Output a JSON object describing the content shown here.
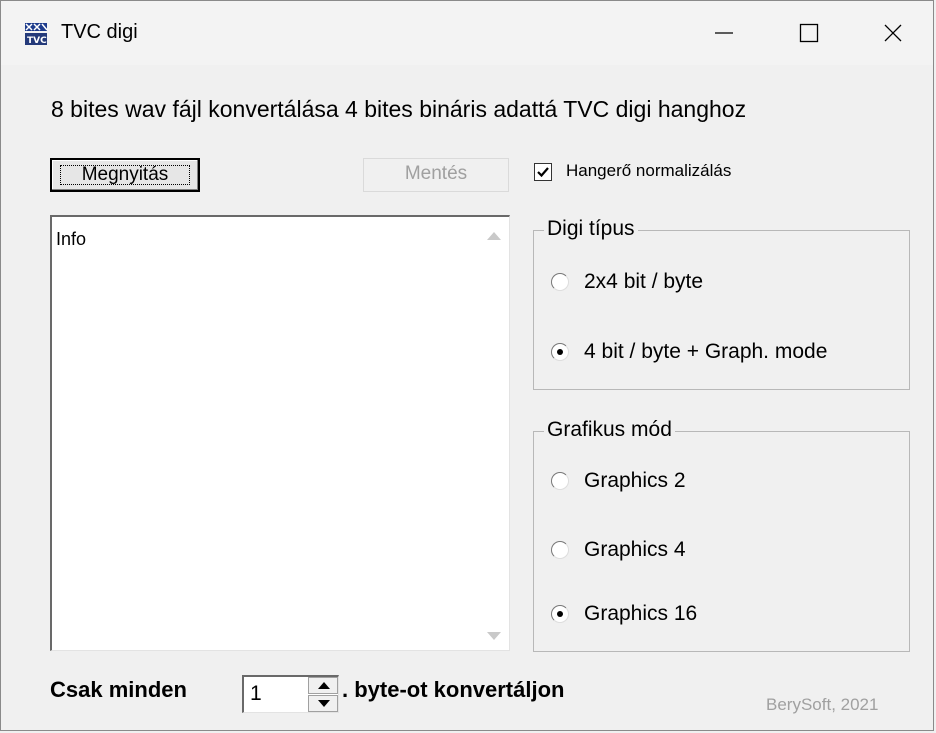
{
  "window": {
    "title": "TVC digi",
    "app_icon": "tvc-app-icon",
    "controls": {
      "minimize_icon": "minimize-icon",
      "maximize_icon": "maximize-icon",
      "close_icon": "close-icon"
    }
  },
  "heading": "8 bites wav fájl konvertálása 4 bites bináris adattá TVC digi hanghoz",
  "buttons": {
    "open_label": "Megnyitás",
    "save_label": "Mentés"
  },
  "info": {
    "text": "Info"
  },
  "normalize": {
    "label": "Hangerő normalizálás",
    "checked": true
  },
  "digi_type": {
    "legend": "Digi típus",
    "options": [
      {
        "label": "2x4 bit / byte",
        "checked": false
      },
      {
        "label": "4 bit / byte + Graph. mode",
        "checked": true
      }
    ]
  },
  "graphics_mode": {
    "legend": "Grafikus mód",
    "options": [
      {
        "label": "Graphics 2",
        "checked": false
      },
      {
        "label": "Graphics 4",
        "checked": false
      },
      {
        "label": "Graphics 16",
        "checked": true
      }
    ]
  },
  "bottom": {
    "prefix": "Csak minden",
    "value": "1",
    "suffix": ". byte-ot konvertáljon"
  },
  "copyright": "BerySoft, 2021",
  "colors": {
    "window_bg": "#f0f0f0",
    "disabled_text": "#a0a0a0"
  }
}
